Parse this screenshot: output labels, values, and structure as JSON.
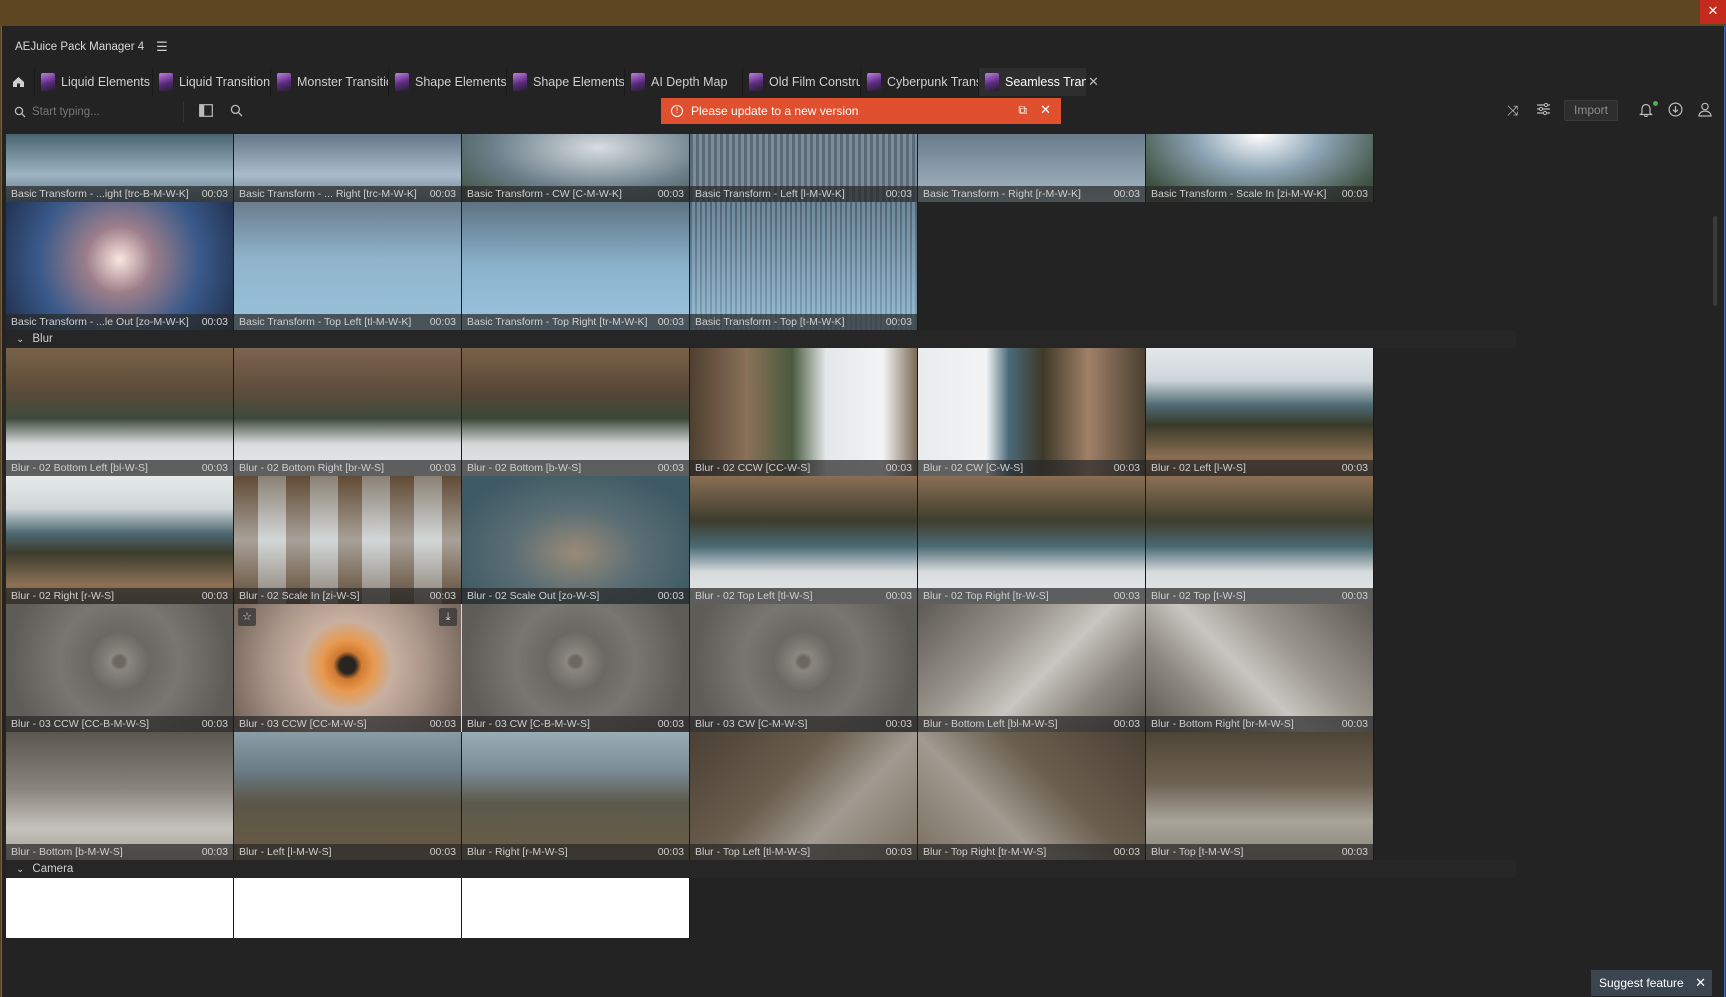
{
  "app": {
    "title": "AEJuice Pack Manager 4",
    "close_glyph": "✕"
  },
  "tabs": [
    {
      "label": "Liquid Elements"
    },
    {
      "label": "Liquid Transitions"
    },
    {
      "label": "Monster Transitions"
    },
    {
      "label": "Shape Elements"
    },
    {
      "label": "Shape Elements"
    },
    {
      "label": "AI Depth Map"
    },
    {
      "label": "Old Film Constructor"
    },
    {
      "label": "Cyberpunk Transitions"
    },
    {
      "label": "Seamless Transitions",
      "active": true
    }
  ],
  "search": {
    "placeholder": "Start typing...",
    "value": ""
  },
  "banner": {
    "text": "Please update to a new version",
    "color": "#e0502e"
  },
  "toolbar": {
    "import_label": "Import"
  },
  "sections": {
    "blur": "Blur",
    "camera": "Camera"
  },
  "row1": [
    {
      "name": "Basic Transform - ...ight [trc-B-M-W-K]",
      "dur": "00:03"
    },
    {
      "name": "Basic Transform - ... Right [trc-M-W-K]",
      "dur": "00:03"
    },
    {
      "name": "Basic Transform - CW [C-M-W-K]",
      "dur": "00:03"
    },
    {
      "name": "Basic Transform - Left [l-M-W-K]",
      "dur": "00:03"
    },
    {
      "name": "Basic Transform - Right [r-M-W-K]",
      "dur": "00:03"
    },
    {
      "name": "Basic Transform - Scale In [zi-M-W-K]",
      "dur": "00:03"
    }
  ],
  "row2": [
    {
      "name": "Basic Transform - ...le Out [zo-M-W-K]",
      "dur": "00:03"
    },
    {
      "name": "Basic Transform - Top Left [tl-M-W-K]",
      "dur": "00:03"
    },
    {
      "name": "Basic Transform - Top Right [tr-M-W-K]",
      "dur": "00:03"
    },
    {
      "name": "Basic Transform - Top [t-M-W-K]",
      "dur": "00:03"
    }
  ],
  "blur1": [
    {
      "name": "Blur - 02 Bottom Left [bl-W-S]",
      "dur": "00:03"
    },
    {
      "name": "Blur - 02 Bottom Right [br-W-S]",
      "dur": "00:03"
    },
    {
      "name": "Blur - 02 Bottom [b-W-S]",
      "dur": "00:03"
    },
    {
      "name": "Blur - 02 CCW [CC-W-S]",
      "dur": "00:03"
    },
    {
      "name": "Blur - 02 CW [C-W-S]",
      "dur": "00:03"
    },
    {
      "name": "Blur - 02 Left [l-W-S]",
      "dur": "00:03"
    }
  ],
  "blur2": [
    {
      "name": "Blur - 02 Right [r-W-S]",
      "dur": "00:03"
    },
    {
      "name": "Blur - 02 Scale In [zi-W-S]",
      "dur": "00:03"
    },
    {
      "name": "Blur - 02 Scale Out [zo-W-S]",
      "dur": "00:03"
    },
    {
      "name": "Blur - 02 Top Left [tl-W-S]",
      "dur": "00:03"
    },
    {
      "name": "Blur - 02 Top Right [tr-W-S]",
      "dur": "00:03"
    },
    {
      "name": "Blur - 02 Top [t-W-S]",
      "dur": "00:03"
    }
  ],
  "blur3": [
    {
      "name": "Blur - 03 CCW [CC-B-M-W-S]",
      "dur": "00:03"
    },
    {
      "name": "Blur - 03 CCW [CC-M-W-S]",
      "dur": "00:03"
    },
    {
      "name": "Blur - 03 CW [C-B-M-W-S]",
      "dur": "00:03"
    },
    {
      "name": "Blur - 03 CW [C-M-W-S]",
      "dur": "00:03"
    },
    {
      "name": "Blur - Bottom Left [bl-M-W-S]",
      "dur": "00:03"
    },
    {
      "name": "Blur - Bottom Right [br-M-W-S]",
      "dur": "00:03"
    }
  ],
  "blur4": [
    {
      "name": "Blur - Bottom [b-M-W-S]",
      "dur": "00:03"
    },
    {
      "name": "Blur - Left [l-M-W-S]",
      "dur": "00:03"
    },
    {
      "name": "Blur - Right [r-M-W-S]",
      "dur": "00:03"
    },
    {
      "name": "Blur - Top Left [tl-M-W-S]",
      "dur": "00:03"
    },
    {
      "name": "Blur - Top Right [tr-M-W-S]",
      "dur": "00:03"
    },
    {
      "name": "Blur - Top [t-M-W-S]",
      "dur": "00:03"
    }
  ],
  "suggest": {
    "label": "Suggest feature"
  }
}
